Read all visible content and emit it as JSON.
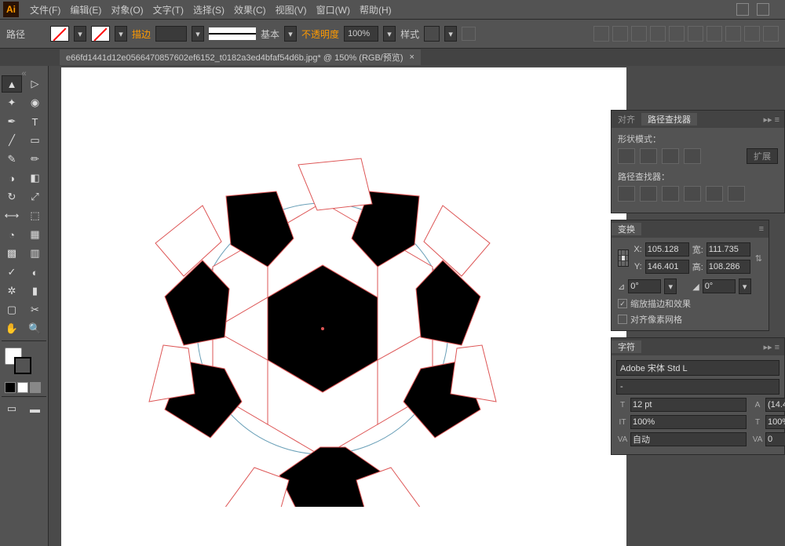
{
  "menubar": {
    "items": [
      "文件(F)",
      "编辑(E)",
      "对象(O)",
      "文字(T)",
      "选择(S)",
      "效果(C)",
      "视图(V)",
      "窗口(W)",
      "帮助(H)"
    ]
  },
  "optionsbar": {
    "selection_label": "路径",
    "stroke_label": "描边",
    "stroke_value": "",
    "profile_label": "基本",
    "opacity_label": "不透明度",
    "opacity_value": "100%",
    "style_label": "样式"
  },
  "document": {
    "tab_title": "e66fd1441d12e0566470857602ef6152_t0182a3ed4bfaf54d6b.jpg* @ 150% (RGB/预览)"
  },
  "align_panel": {
    "tab_align": "对齐",
    "tab_pathfinder": "路径查找器",
    "shape_modes_label": "形状模式：",
    "expand_label": "扩展",
    "pathfinders_label": "路径查找器："
  },
  "transform_panel": {
    "tab": "变换",
    "x_label": "X:",
    "x_value": "105.128",
    "y_label": "Y:",
    "y_value": "146.401",
    "w_label": "宽:",
    "w_value": "111.735",
    "h_label": "高:",
    "h_value": "108.286",
    "rotate_value": "0°",
    "shear_value": "0°",
    "scale_strokes": "缩放描边和效果",
    "pixel_grid": "对齐像素网格"
  },
  "character_panel": {
    "tab": "字符",
    "font_family": "Adobe 宋体 Std L",
    "font_style": "-",
    "font_size": "12 pt",
    "leading": "(14.4",
    "vscale": "100%",
    "hscale": "100%",
    "kerning": "自动",
    "tracking": "0"
  },
  "chart_data": null
}
